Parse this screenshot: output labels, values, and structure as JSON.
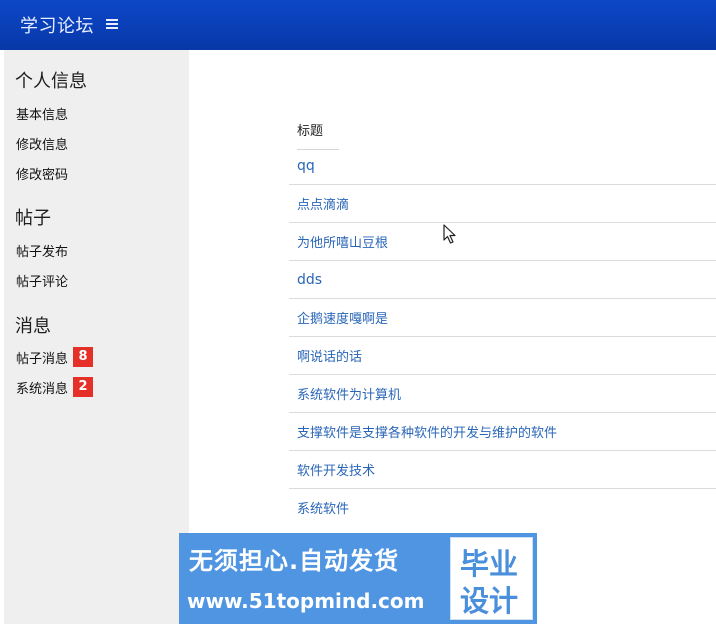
{
  "header": {
    "title": "学习论坛",
    "menu_icon": "menu-icon"
  },
  "sidebar": {
    "sections": [
      {
        "title": "个人信息",
        "items": [
          {
            "label": "基本信息"
          },
          {
            "label": "修改信息"
          },
          {
            "label": "修改密码"
          }
        ]
      },
      {
        "title": "帖子",
        "items": [
          {
            "label": "帖子发布"
          },
          {
            "label": "帖子评论"
          }
        ]
      },
      {
        "title": "消息",
        "items": [
          {
            "label": "帖子消息",
            "badge": "8"
          },
          {
            "label": "系统消息",
            "badge": "2"
          }
        ]
      }
    ]
  },
  "table": {
    "header": "标题",
    "rows": [
      "qq",
      "点点滴滴",
      "为他所嘻山豆根",
      "dds",
      "企鹅速度嘎啊是",
      "啊说话的话",
      "系统软件为计算机",
      "支撑软件是支撑各种软件的开发与维护的软件",
      "软件开发技术",
      "系统软件"
    ]
  },
  "watermark": {
    "line1": "无须担心.自动发货",
    "line2": "www.51topmind.com",
    "box_line1": "毕业",
    "box_line2": "设计"
  },
  "colors": {
    "topbar": "#0a3fb7",
    "sidebar_bg": "#efefef",
    "link": "#2a66b8",
    "badge": "#e5302a",
    "watermark_bg": "#4f95e2"
  }
}
